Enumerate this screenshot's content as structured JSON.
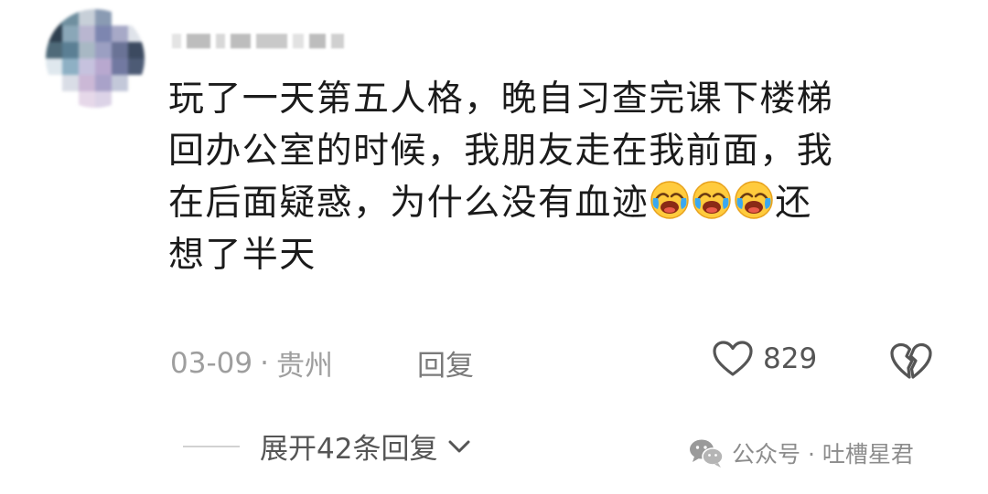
{
  "comment": {
    "line1": "玩了一天第五人格，晚自习查完课下楼梯",
    "line2": "回办公室的时候，我朋友走在我前面，我",
    "line3_before": "在后面疑惑，为什么没有血迹",
    "line3_after": "还",
    "line4": "想了半天"
  },
  "meta": {
    "date": "03-09",
    "separator": "·",
    "location": "贵州",
    "reply_label": "回复"
  },
  "like": {
    "count": "829"
  },
  "expand": {
    "label": "展开42条回复"
  },
  "watermark": {
    "text": "公众号 · 吐槽星君"
  },
  "colors": {
    "text": "#1b1b1b",
    "meta": "#9e9e9e",
    "icon": "#555555"
  },
  "icons": {
    "like": "heart-icon",
    "dislike": "broken-heart-icon",
    "expand": "chevron-down-icon",
    "emoji": "laughing-crying-emoji-icon",
    "watermark": "wechat-icon"
  }
}
